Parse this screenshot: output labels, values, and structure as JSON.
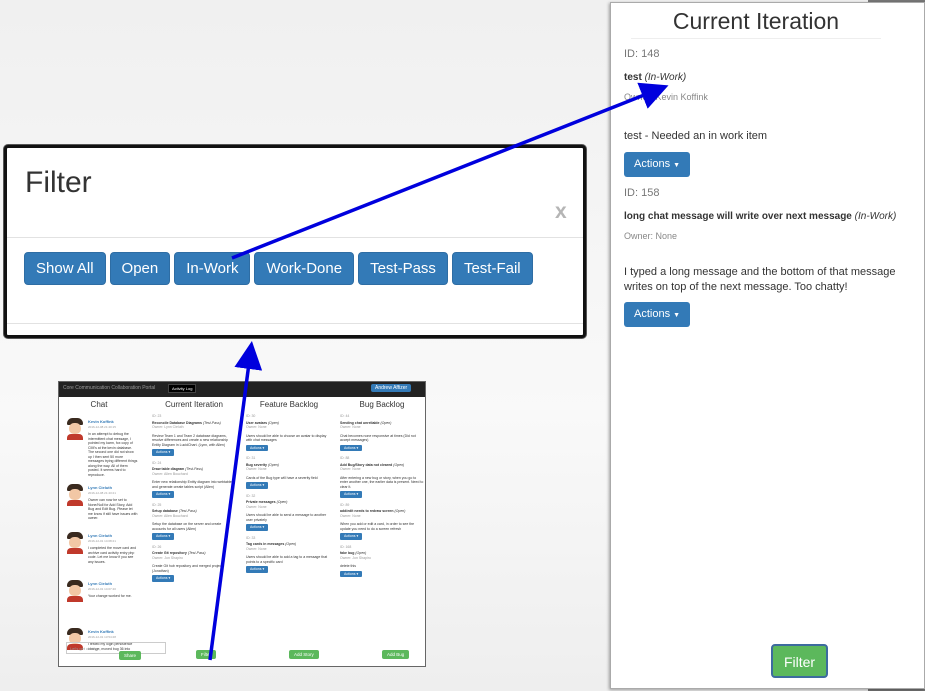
{
  "filter_dialog": {
    "title": "Filter",
    "close_label": "x",
    "buttons": [
      "Show All",
      "Open",
      "In-Work",
      "Work-Done",
      "Test-Pass",
      "Test-Fail"
    ]
  },
  "current_panel": {
    "title": "Current Iteration",
    "cards": [
      {
        "id": "ID: 148",
        "title": "test",
        "state": "(In-Work)",
        "owner": "Owner: Kevin Koffink",
        "description": "test - Needed an in work item",
        "actions_label": "Actions"
      },
      {
        "id": "ID: 158",
        "title": "long chat message will write over next message",
        "state": "(In-Work)",
        "owner": "Owner: None",
        "description": "I typed a long message and the bottom of that message writes on top of the next message. Too chatty!",
        "actions_label": "Actions"
      }
    ],
    "filter_button": "Filter"
  },
  "thumbnail": {
    "brand": "Core Communication Collaboration Portal",
    "tab": "Activity Log",
    "user": "Andrew Affizer",
    "columns": [
      "Chat",
      "Current Iteration",
      "Feature Backlog",
      "Bug Backlog"
    ],
    "chat": [
      {
        "name": "Kevin Koffink",
        "time": "2016-12-08 21:40:15",
        "message": "In an attempt to debug the intermittent chat message, I pointed my karm, fox copy of CIM's at the kevin database. The second one did not show up I then sent 50 more messages trying different things along the way. All of them posted. It seems hard to reproduce."
      },
      {
        "name": "Lynn Cieluth",
        "time": "2016-12-08 21:43:21",
        "message": "Owner can now be set to None/Null for Add Story, Add Bug and Edit Bug. Please let me know if still have issues with owner."
      },
      {
        "name": "Lynn Cieluth",
        "time": "2016-12-01 14:08:21",
        "message": "I completed the move card and archive card activity entry php code. Let me know if you see any issues."
      },
      {
        "name": "Lynn Cieluth",
        "time": "2016-12-01 14:07:40",
        "message": "Your change worked for me."
      },
      {
        "name": "Kevin Koffink",
        "time": "2016-12-01 13:54:28",
        "message": "I tested my login persistence change, moved bug 36 into"
      }
    ],
    "chat_placeholder": "Let's get chatty...",
    "share_label": "Share",
    "iteration": [
      {
        "id": "ID: 23",
        "title": "Reconcile Database Diagrams",
        "state": "(Test-Pass)",
        "owner": "Owner: Lynn Cieluth",
        "desc": "Review Team 1 and Team 2 database diagrams, resolve differences and create a new relationship Entity Diagram in LucidChart. (Lynn, with Allen)"
      },
      {
        "id": "ID: 24",
        "title": "Draw table diagram",
        "state": "(Test-Pass)",
        "owner": "Owner: Allen Bouchard",
        "desc": "Enter new relationship Entity diagram into webtables and generate create tables script (Allen)"
      },
      {
        "id": "ID: 25",
        "title": "Setup database",
        "state": "(Test-Pass)",
        "owner": "Owner: Allen Bouchard",
        "desc": "Setup the database on the server and create accounts for all users (Allen)"
      },
      {
        "id": "ID: 26",
        "title": "Create Git repository",
        "state": "(Test-Pass)",
        "owner": "Owner: Jon Shapiro",
        "desc": "Create Git hub repository and merged project (Jonathan)"
      }
    ],
    "features": [
      {
        "id": "ID: 30",
        "title": "User avatars",
        "state": "(Open)",
        "owner": "Owner: None",
        "desc": "Users should be able to choose an avatar to display with chat messages"
      },
      {
        "id": "ID: 31",
        "title": "Bug severity",
        "state": "(Open)",
        "owner": "Owner: None",
        "desc": "Cards of the Bug type will have a severity field"
      },
      {
        "id": "ID: 32",
        "title": "Private messages",
        "state": "(Open)",
        "owner": "Owner: None",
        "desc": "Users should be able to send a message to another user privately"
      },
      {
        "id": "ID: 33",
        "title": "Tag cards in messages",
        "state": "(Open)",
        "owner": "Owner: None",
        "desc": "Users should be able to add a tag to a message that points to a specific card"
      }
    ],
    "bugs": [
      {
        "id": "ID: 44",
        "title": "Sending chat unreliable",
        "state": "(Open)",
        "owner": "Owner: None",
        "desc": "Chat becomes none responsive at times (Did not accept messages)"
      },
      {
        "id": "ID: 88",
        "title": "Add Bug/Story data not cleared",
        "state": "(Open)",
        "owner": "Owner: None",
        "desc": "After entering a new bug or story, when you go to enter another one, the earlier data is present. Need to clear it."
      },
      {
        "id": "ID: 89",
        "title": "add/edit needs to redraw screen",
        "state": "(Open)",
        "owner": "Owner: None",
        "desc": "When you add or edit a card, in order to see the update you need to do a screen refresh"
      },
      {
        "id": "ID: 168",
        "title": "fake bug",
        "state": "(Open)",
        "owner": "Owner: Jon Shapiro",
        "desc": "delete this"
      }
    ],
    "actions_label": "Actions",
    "filter_label": "Filter",
    "add_story_label": "Add Story",
    "add_bug_label": "Add Bug"
  },
  "colors": {
    "primary_button": "#337ab7",
    "success_button": "#5cb85c",
    "arrow": "#0000dd"
  },
  "icons": [
    "close-icon",
    "caret-down-icon",
    "avatar-icon",
    "arrow-annotation"
  ]
}
